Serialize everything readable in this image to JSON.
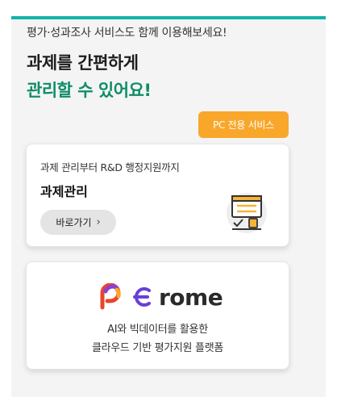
{
  "intro": "평가·성과조사 서비스도 함께 이용해보세요!",
  "headline": {
    "line1": "과제를 간편하게",
    "line2": "관리할 수 있어요!"
  },
  "pc_badge": "PC 전용 서비스",
  "task_card": {
    "desc": "과제 관리부터 R&D 행정지원까지",
    "title": "과제관리",
    "button": "바로가기",
    "button_chevron": "›",
    "icon": "document-checklist-icon"
  },
  "erome_card": {
    "logo_text": "rome",
    "logo_icon": "erome-logo-icon",
    "line1": "AI와 빅데이터를 활용한",
    "line2": "클라우드 기반 평가지원 플랫폼"
  },
  "colors": {
    "accent_bar": "#12b3a8",
    "headline_green": "#0d8d68",
    "badge_orange": "#f9a72a"
  }
}
